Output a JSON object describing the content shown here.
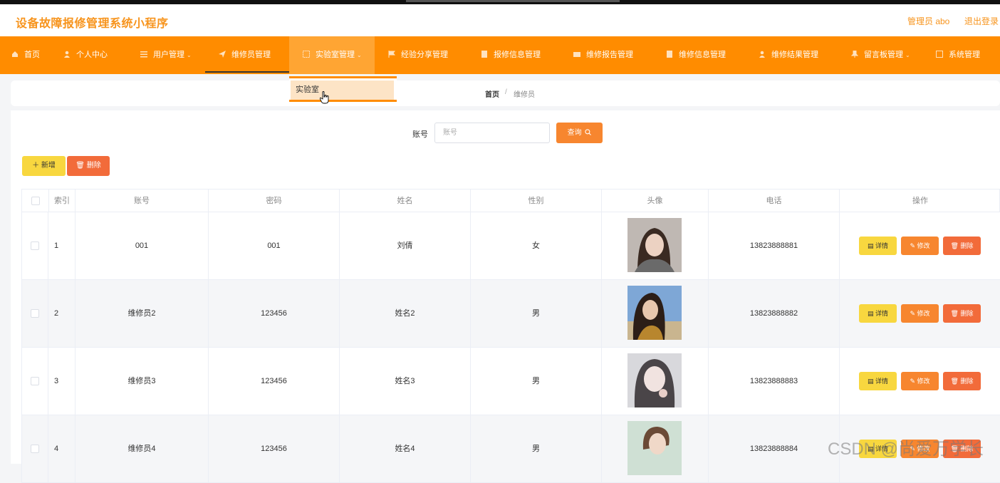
{
  "header": {
    "title": "设备故障报修管理系统小程序",
    "user": "管理员 abo",
    "logout": "退出登录"
  },
  "nav": {
    "items": [
      {
        "label": "首页",
        "icon": "home-icon"
      },
      {
        "label": "个人中心",
        "icon": "user-icon"
      },
      {
        "label": "用户管理",
        "icon": "list-icon"
      },
      {
        "label": "维修员管理",
        "icon": "send-icon"
      },
      {
        "label": "实验室管理",
        "icon": "grid-icon"
      },
      {
        "label": "经验分享管理",
        "icon": "flag-icon"
      },
      {
        "label": "报修信息管理",
        "icon": "doc-icon"
      },
      {
        "label": "维修报告管理",
        "icon": "mail-icon"
      },
      {
        "label": "维修信息管理",
        "icon": "doc-icon"
      },
      {
        "label": "维修结果管理",
        "icon": "user-icon"
      },
      {
        "label": "留言板管理",
        "icon": "pin-icon"
      },
      {
        "label": "系统管理",
        "icon": "setting-icon"
      }
    ],
    "dropdown_option": "实验室"
  },
  "breadcrumb": {
    "home": "首页",
    "separator": "/",
    "current": "维修员"
  },
  "search": {
    "label": "账号",
    "placeholder": "账号",
    "button": "查询"
  },
  "actions": {
    "add": "新增",
    "delete": "删除"
  },
  "table": {
    "headers": [
      "索引",
      "账号",
      "密码",
      "姓名",
      "性别",
      "头像",
      "电话",
      "操作"
    ],
    "rows": [
      {
        "index": "1",
        "account": "001",
        "password": "001",
        "name": "刘倩",
        "gender": "女",
        "phone": "13823888881"
      },
      {
        "index": "2",
        "account": "维修员2",
        "password": "123456",
        "name": "姓名2",
        "gender": "男",
        "phone": "13823888882"
      },
      {
        "index": "3",
        "account": "维修员3",
        "password": "123456",
        "name": "姓名3",
        "gender": "男",
        "phone": "13823888883"
      },
      {
        "index": "4",
        "account": "维修员4",
        "password": "123456",
        "name": "姓名4",
        "gender": "男",
        "phone": "13823888884"
      }
    ],
    "op_detail": "详情",
    "op_edit": "修改",
    "op_delete": "删除"
  },
  "colors": {
    "accent": "#ff8c00",
    "title": "#f7941d",
    "yellow": "#f8d73f",
    "orange": "#f7862f",
    "red": "#f26b3a"
  },
  "watermark": "CSDN @尚爱万学长"
}
